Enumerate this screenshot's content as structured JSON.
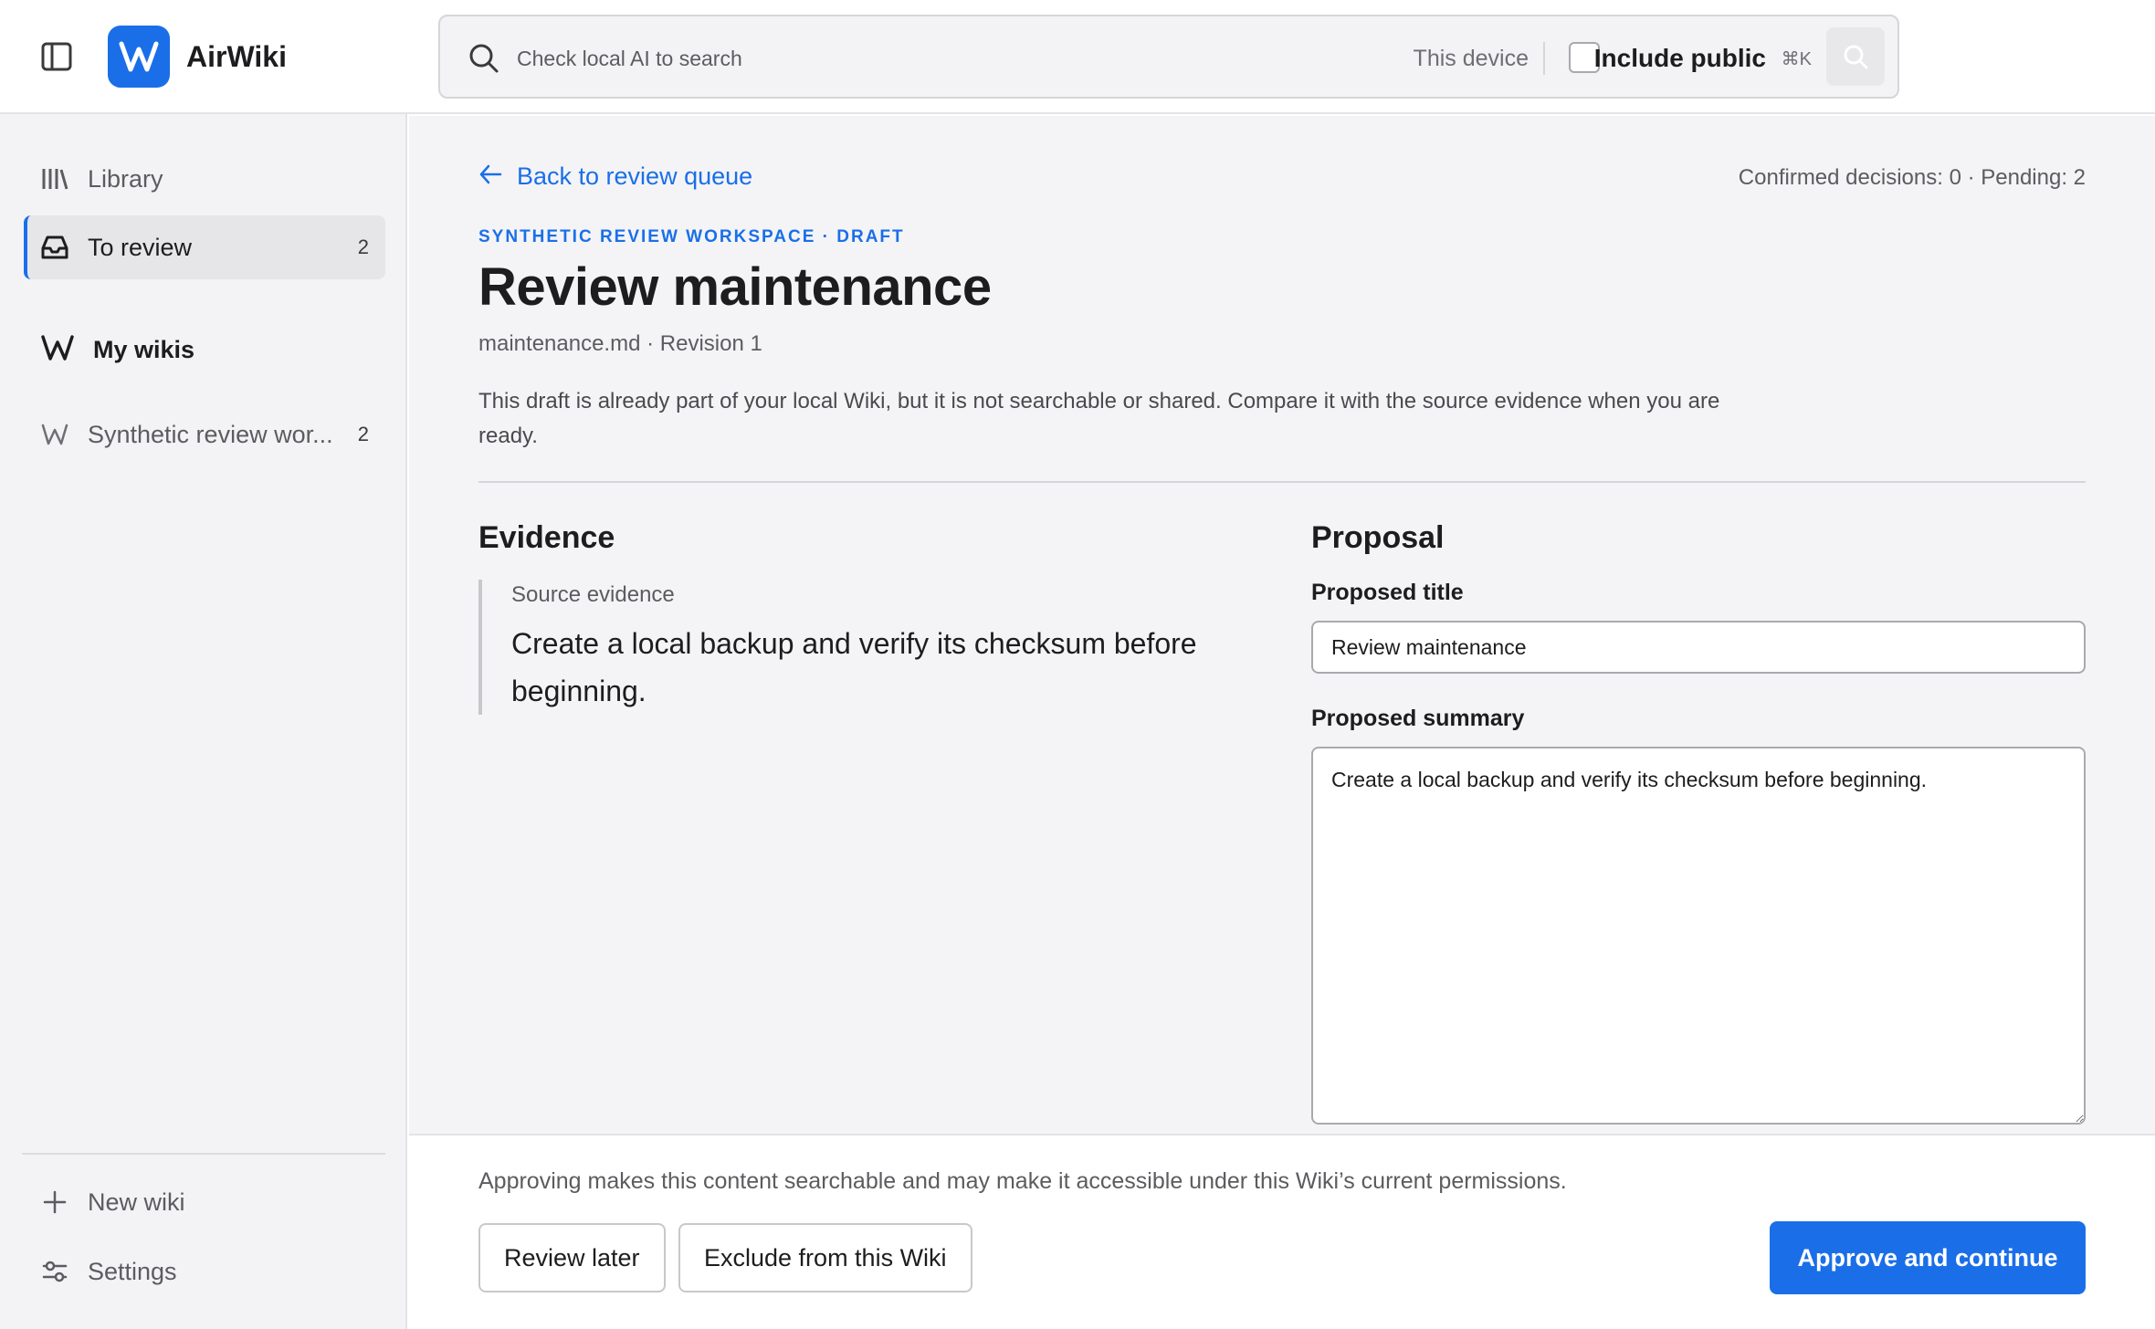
{
  "app": {
    "name": "AirWiki",
    "brand_color": "#1a6fe8"
  },
  "search": {
    "placeholder": "Check local AI to search",
    "scope_label": "This device",
    "include_public_label": "Include public",
    "include_public_checked": false,
    "shortcut": "⌘K"
  },
  "sidebar": {
    "items": [
      {
        "label": "Library",
        "icon": "library-icon"
      },
      {
        "label": "To review",
        "icon": "inbox-icon",
        "count": "2",
        "active": true
      }
    ],
    "section_heading": "My wikis",
    "wikis": [
      {
        "label": "Synthetic review wor...",
        "icon": "wiki-icon",
        "count": "2"
      }
    ],
    "footer_items": [
      {
        "label": "New wiki",
        "icon": "plus-icon"
      },
      {
        "label": "Settings",
        "icon": "settings-icon"
      }
    ]
  },
  "main": {
    "back_label": "Back to review queue",
    "decision_status": "Confirmed decisions: 0 · Pending: 2",
    "eyebrow": "SYNTHETIC REVIEW WORKSPACE · DRAFT",
    "title": "Review maintenance",
    "file_meta": "maintenance.md · Revision 1",
    "intro": "This draft is already part of your local Wiki, but it is not searchable or shared. Compare it with the source evidence when you are ready.",
    "evidence": {
      "heading": "Evidence",
      "label": "Source evidence",
      "text": "Create a local backup and verify its checksum before beginning."
    },
    "proposal": {
      "heading": "Proposal",
      "title_label": "Proposed title",
      "title_value": "Review maintenance",
      "summary_label": "Proposed summary",
      "summary_value": "Create a local backup and verify its checksum before beginning."
    }
  },
  "footer": {
    "note": "Approving makes this content searchable and may make it accessible under this Wiki’s current permissions.",
    "review_later": "Review later",
    "exclude": "Exclude from this Wiki",
    "approve": "Approve and continue"
  }
}
